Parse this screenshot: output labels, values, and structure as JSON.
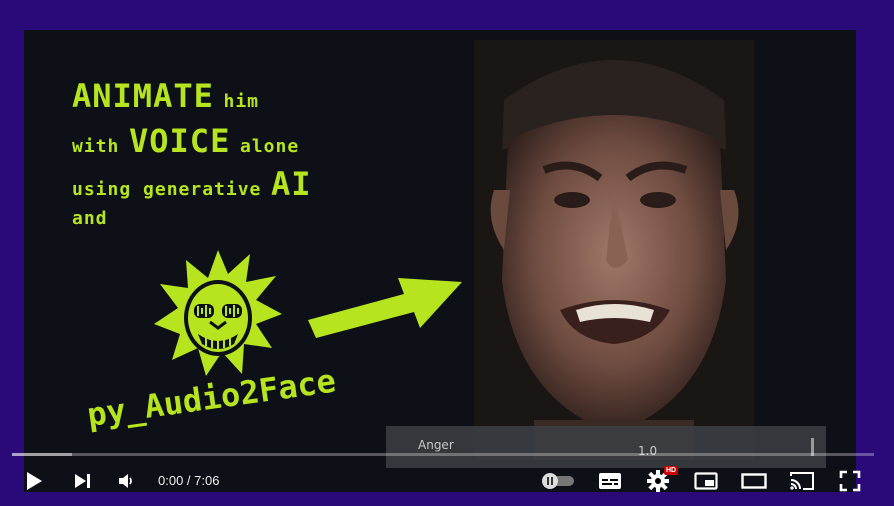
{
  "video": {
    "headline": {
      "line1_big": "ANIMATE",
      "line1_small": "him",
      "line2_small_a": "with",
      "line2_big": "VOICE",
      "line2_small_b": "alone",
      "line3_small": "using generative",
      "line3_big": "AI",
      "line4_small": "and"
    },
    "brand": "py_Audio2Face",
    "overlay": {
      "label": "Anger",
      "value": "1.0"
    },
    "accent_color": "#b6e51f",
    "frame_color": "#2a0a78"
  },
  "player": {
    "time_display": "0:00 / 7:06",
    "progress_fraction": 0,
    "hd_badge": "HD",
    "controls": {
      "play": "play-icon",
      "next": "next-icon",
      "volume": "volume-icon",
      "autoplay": "autoplay-toggle-icon",
      "subtitles": "subtitles-icon",
      "settings": "gear-icon",
      "miniplayer": "miniplayer-icon",
      "theater": "theater-icon",
      "cast": "cast-icon",
      "fullscreen": "fullscreen-icon"
    }
  }
}
